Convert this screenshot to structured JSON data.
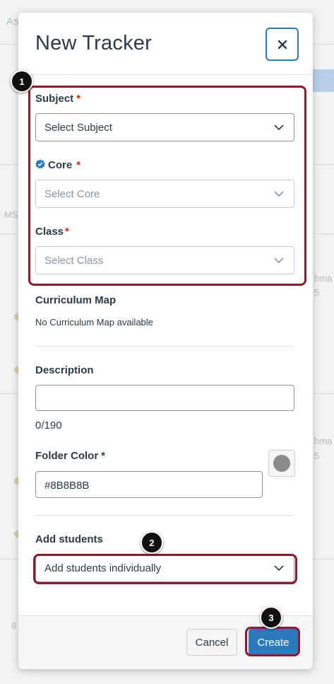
{
  "modal": {
    "title": "New Tracker",
    "close_icon": "close-icon"
  },
  "form": {
    "subject": {
      "label": "Subject",
      "required": "*",
      "value": "Select Subject"
    },
    "core": {
      "label": "Core",
      "required": "*",
      "placeholder": "Select Core",
      "icon": "verified-badge-icon"
    },
    "class": {
      "label": "Class",
      "required": "*",
      "placeholder": "Select Class"
    },
    "curriculum_map": {
      "label": "Curriculum Map",
      "value": "No Curriculum Map available"
    },
    "description": {
      "label": "Description",
      "value": "",
      "counter": "0/190"
    },
    "folder_color": {
      "label": "Folder Color",
      "required": "*",
      "value": "#8B8B8B"
    },
    "add_students": {
      "label": "Add students",
      "value": "Add students individually"
    }
  },
  "footer": {
    "cancel_label": "Cancel",
    "create_label": "Create"
  },
  "callouts": {
    "one": "1",
    "two": "2",
    "three": "3"
  },
  "background": {
    "fragments": [
      "As",
      "MS",
      "hma",
      "5",
      "hma",
      "5",
      "6"
    ]
  },
  "colors": {
    "accent": "#2B7ABC",
    "required": "#C4281B",
    "callout": "#8B1A2A",
    "folder_color": "#8B8B8B"
  }
}
